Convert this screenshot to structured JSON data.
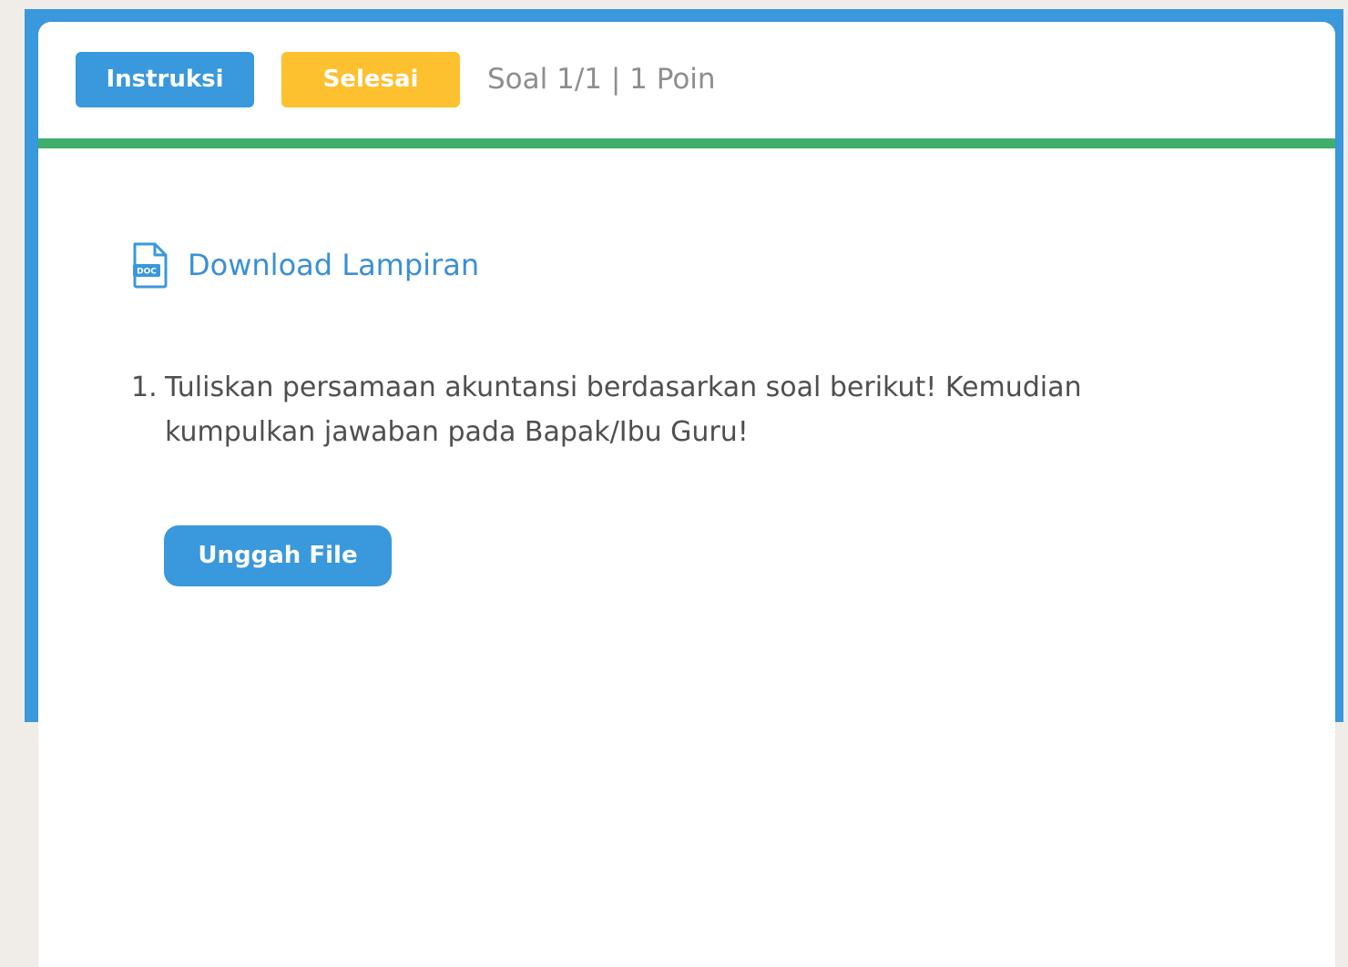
{
  "header": {
    "instruksi_label": "Instruksi",
    "selesai_label": "Selesai",
    "question_meta": "Soal 1/1 | 1 Poin"
  },
  "attachment": {
    "label": "Download Lampiran",
    "icon": "doc-file-icon",
    "icon_text": "DOC"
  },
  "question": {
    "number": "1.",
    "text": "Tuliskan persamaan akuntansi berdasarkan soal berikut! Kemudian kumpulkan jawaban pada Bapak/Ibu Guru!"
  },
  "upload": {
    "label": "Unggah File"
  },
  "colors": {
    "primary": "#3a98dc",
    "warning": "#fdc02f",
    "progress": "#3fae6a",
    "link": "#3a8fd6",
    "muted_text": "#8e8e8e",
    "body_text": "#4f4f4f"
  }
}
